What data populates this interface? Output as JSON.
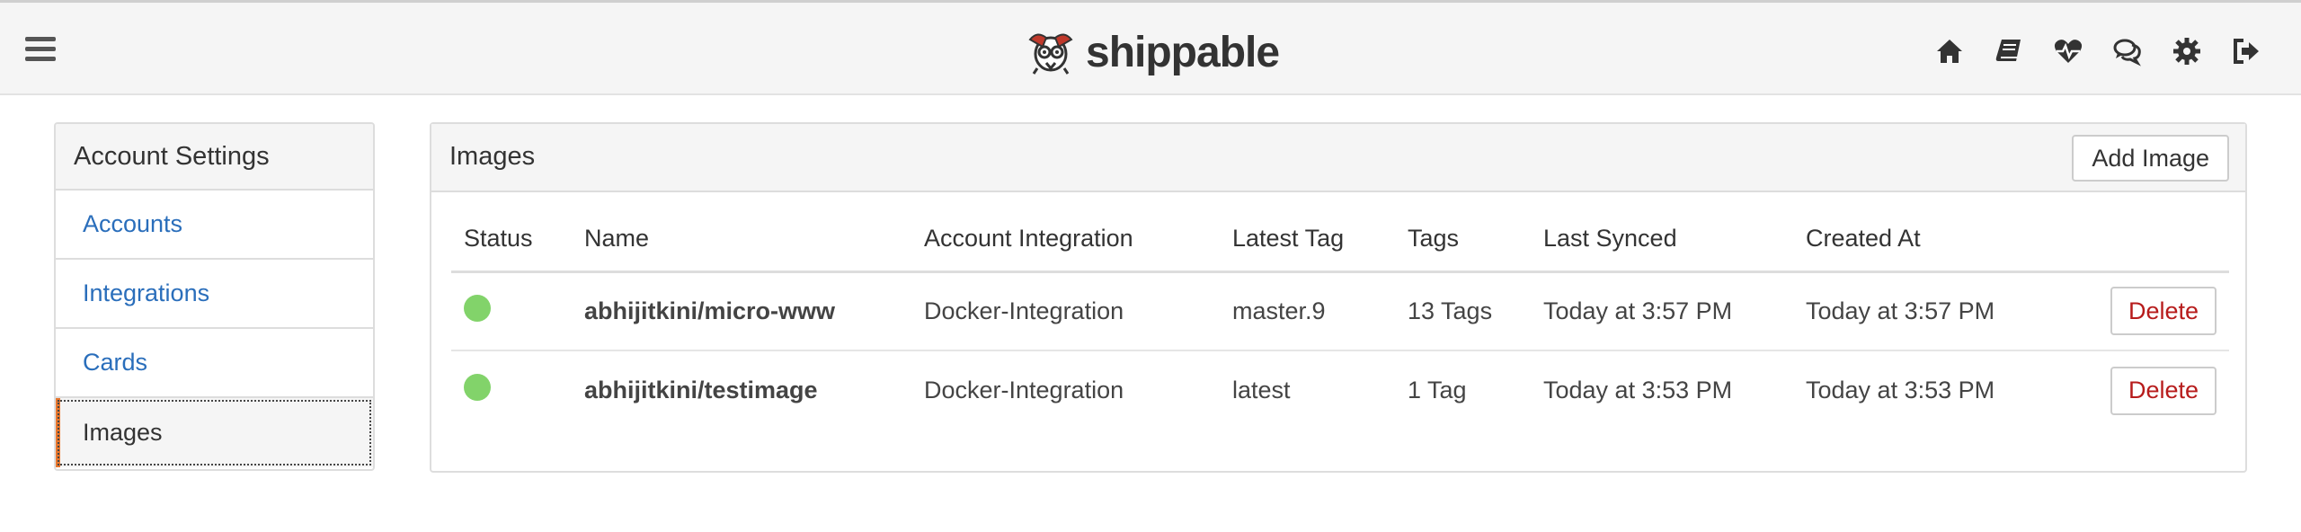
{
  "navbar": {
    "brand": "shippable",
    "icons": [
      "home-icon",
      "book-icon",
      "heartbeat-icon",
      "comments-icon",
      "gear-icon",
      "sign-out-icon"
    ]
  },
  "sidebar": {
    "title": "Account Settings",
    "items": [
      {
        "label": "Accounts",
        "active": false
      },
      {
        "label": "Integrations",
        "active": false
      },
      {
        "label": "Cards",
        "active": false
      },
      {
        "label": "Images",
        "active": true
      }
    ]
  },
  "images_panel": {
    "title": "Images",
    "add_button": "Add Image",
    "columns": [
      "Status",
      "Name",
      "Account Integration",
      "Latest Tag",
      "Tags",
      "Last Synced",
      "Created At"
    ],
    "rows": [
      {
        "status_color": "#82d36a",
        "name": "abhijitkini/micro-www",
        "integration": "Docker-Integration",
        "latest_tag": "master.9",
        "tags": "13 Tags",
        "last_synced": "Today at 3:57 PM",
        "created_at": "Today at 3:57 PM",
        "delete_label": "Delete"
      },
      {
        "status_color": "#82d36a",
        "name": "abhijitkini/testimage",
        "integration": "Docker-Integration",
        "latest_tag": "latest",
        "tags": "1 Tag",
        "last_synced": "Today at 3:53 PM",
        "created_at": "Today at 3:53 PM",
        "delete_label": "Delete"
      }
    ]
  },
  "colors": {
    "link": "#2a6ebb",
    "active_accent": "#e8772e",
    "delete_text": "#b71c1c",
    "status_ok": "#82d36a"
  }
}
